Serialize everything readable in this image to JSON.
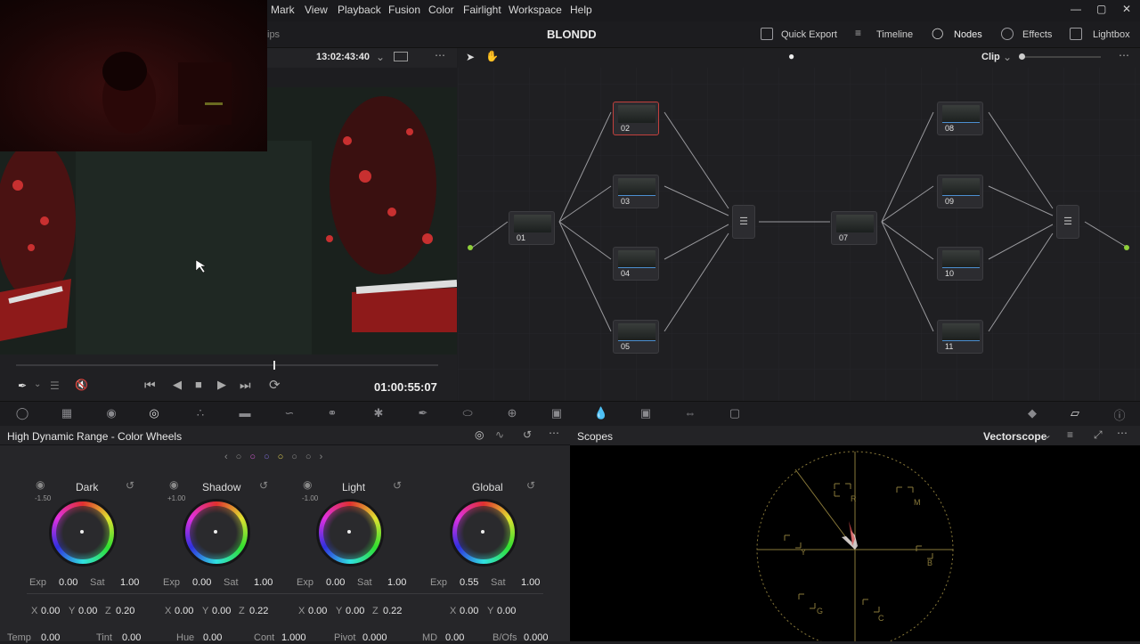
{
  "menu": [
    "Mark",
    "View",
    "Playback",
    "Fusion",
    "Color",
    "Fairlight",
    "Workspace",
    "Help"
  ],
  "project_title": "BLONDD",
  "toolbar": {
    "clips_partial": "ips",
    "timecode_source": "13:02:43:40",
    "quick_export": "Quick Export",
    "timeline": "Timeline",
    "nodes": "Nodes",
    "effects": "Effects",
    "lightbox": "Lightbox",
    "clip_mode": "Clip"
  },
  "transport": {
    "timecode": "01:00:55:07"
  },
  "nodes": [
    "01",
    "02",
    "03",
    "04",
    "05",
    "07",
    "08",
    "09",
    "10",
    "11"
  ],
  "wheels_panel": {
    "title": "High Dynamic Range - Color Wheels",
    "wheels": [
      {
        "name": "Dark",
        "offset": "-1.50",
        "exp": "0.00",
        "sat": "1.00",
        "x": "0.00",
        "y": "0.00",
        "z": "0.20"
      },
      {
        "name": "Shadow",
        "offset": "+1.00",
        "exp": "0.00",
        "sat": "1.00",
        "x": "0.00",
        "y": "0.00",
        "z": "0.22"
      },
      {
        "name": "Light",
        "offset": "-1.00",
        "exp": "0.00",
        "sat": "1.00",
        "x": "0.00",
        "y": "0.00",
        "z": "0.22"
      },
      {
        "name": "Global",
        "offset": "",
        "exp": "0.55",
        "sat": "1.00",
        "x": "0.00",
        "y": "0.00",
        "z": ""
      }
    ],
    "labels": {
      "exp": "Exp",
      "sat": "Sat",
      "x": "X",
      "y": "Y",
      "z": "Z"
    },
    "bottom": [
      {
        "label": "Temp",
        "value": "0.00"
      },
      {
        "label": "Tint",
        "value": "0.00"
      },
      {
        "label": "Hue",
        "value": "0.00"
      },
      {
        "label": "Cont",
        "value": "1.000"
      },
      {
        "label": "Pivot",
        "value": "0.000"
      },
      {
        "label": "MD",
        "value": "0.00"
      },
      {
        "label": "B/Ofs",
        "value": "0.000"
      }
    ]
  },
  "scopes": {
    "title": "Scopes",
    "mode": "Vectorscope",
    "targets": [
      "R",
      "M",
      "B",
      "C",
      "G",
      "Y"
    ]
  },
  "colors": {
    "accent_green": "#8fd03a",
    "accent_blue": "#3aa3dd",
    "selected_red": "#c2403d"
  }
}
